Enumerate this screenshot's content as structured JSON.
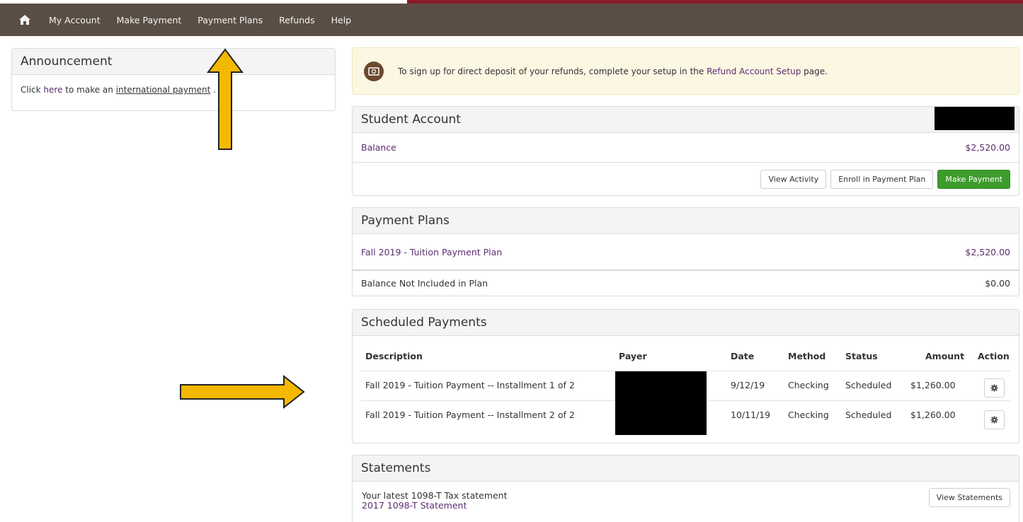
{
  "nav": {
    "home_icon": "home-icon",
    "items": [
      "My Account",
      "Make Payment",
      "Payment Plans",
      "Refunds",
      "Help"
    ]
  },
  "announcement": {
    "title": "Announcement",
    "text_pre": "Click ",
    "here_link": "here",
    "text_mid": " to make an ",
    "intl_link": "international payment",
    "text_post": " ."
  },
  "refund_alert": {
    "icon": "money-icon",
    "text_pre": "To sign up for direct deposit of your refunds, complete your setup in the ",
    "link": "Refund Account Setup",
    "text_post": " page."
  },
  "student_account": {
    "title": "Student Account",
    "balance_label": "Balance",
    "balance_value": "$2,520.00",
    "buttons": {
      "view_activity": "View Activity",
      "enroll": "Enroll in Payment Plan",
      "make_payment": "Make Payment"
    }
  },
  "payment_plans": {
    "title": "Payment Plans",
    "plan_name": "Fall 2019 - Tuition Payment Plan",
    "plan_amount": "$2,520.00",
    "not_included_label": "Balance Not Included in Plan",
    "not_included_amount": "$0.00"
  },
  "scheduled_payments": {
    "title": "Scheduled Payments",
    "columns": [
      "Description",
      "Payer",
      "Date",
      "Method",
      "Status",
      "Amount",
      "Action"
    ],
    "rows": [
      {
        "description": "Fall 2019 - Tuition Payment -- Installment 1 of 2",
        "date": "9/12/19",
        "method": "Checking",
        "status": "Scheduled",
        "amount": "$1,260.00"
      },
      {
        "description": "Fall 2019 - Tuition Payment -- Installment 2 of 2",
        "date": "10/11/19",
        "method": "Checking",
        "status": "Scheduled",
        "amount": "$1,260.00"
      }
    ]
  },
  "statements": {
    "title": "Statements",
    "latest_label": "Your latest 1098-T Tax statement",
    "statement_link": "2017 1098-T Statement",
    "view_button": "View Statements"
  },
  "colors": {
    "nav_bg": "#5a4e44",
    "accent_red": "#8b1a2b",
    "link_purple": "#5b2c6f",
    "green_button": "#3b9c2c",
    "alert_bg": "#fcf7e3",
    "arrow_yellow": "#f5b800"
  }
}
